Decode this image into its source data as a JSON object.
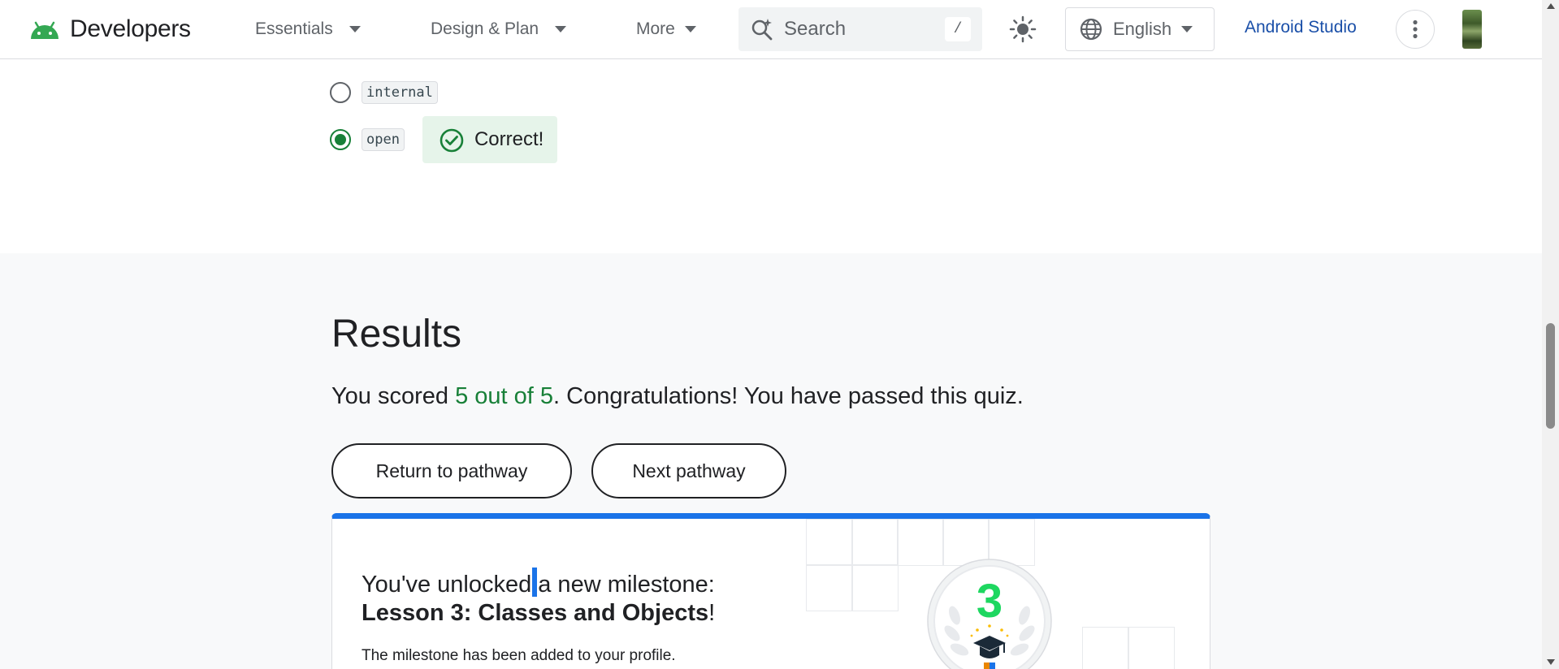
{
  "nav": {
    "brand": "Developers",
    "tabs": [
      {
        "label": "Essentials"
      },
      {
        "label": "Design & Plan"
      },
      {
        "label": "More"
      }
    ],
    "search_placeholder": "Search",
    "search_shortcut": "/",
    "language": "English",
    "studio_link": "Android Studio"
  },
  "quiz": {
    "options": [
      {
        "code": "internal",
        "selected": false
      },
      {
        "code": "open",
        "selected": true
      }
    ],
    "feedback": "Correct!"
  },
  "results": {
    "title": "Results",
    "score_prefix": "You scored ",
    "score_value": "5 out of 5",
    "score_suffix": ". Congratulations! You have passed this quiz.",
    "return_button": "Return to pathway",
    "next_button": "Next pathway"
  },
  "milestone": {
    "line1_before_cursor": "You've unlocked",
    "line1_after_cursor": "a new milestone:",
    "lesson_title": "Lesson 3: Classes and Objects",
    "lesson_suffix": "!",
    "note": "The milestone has been added to your profile.",
    "badge_number": "3"
  },
  "colors": {
    "accent_blue": "#1a73e8",
    "link_blue": "#1a4fa8",
    "success_green": "#188038",
    "badge_green": "#1ed760",
    "android_green": "#34a853"
  }
}
